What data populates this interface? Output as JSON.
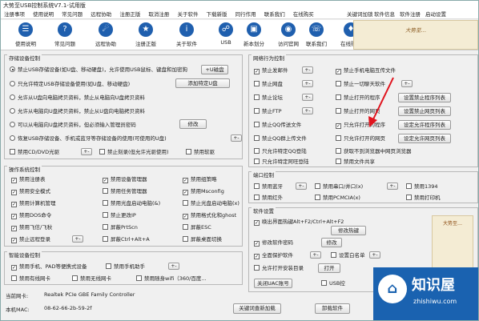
{
  "window": {
    "title": "大势至USB控制系统V7.1-试用版"
  },
  "menu": {
    "items": [
      "注册事项",
      "使用说明",
      "常见问题",
      "远程协助",
      "注册正版",
      "取消注册",
      "关于软件",
      "下载新版",
      "同行作用",
      "联系我们",
      "在线购买"
    ],
    "right": [
      "关键词加锁",
      "软件信息",
      "软件注册",
      "启动设置"
    ]
  },
  "toolbar": [
    {
      "label": "使用说明",
      "icon": "book-icon"
    },
    {
      "label": "常见问题",
      "icon": "question-icon"
    },
    {
      "label": "远程协助",
      "icon": "remote-icon"
    },
    {
      "label": "注册正版",
      "icon": "register-icon"
    },
    {
      "label": "关于软件",
      "icon": "info-icon"
    },
    {
      "label": "USB",
      "icon": "usb-icon"
    },
    {
      "label": "新本划分",
      "icon": "split-icon"
    },
    {
      "label": "访问官网",
      "icon": "globe-icon"
    },
    {
      "label": "联系我们",
      "icon": "contact-icon"
    },
    {
      "label": "在线购买",
      "icon": "cart-icon"
    }
  ],
  "banner": {
    "text": "大势至…"
  },
  "storage": {
    "title": "存储设备控制",
    "options": [
      {
        "label": "禁止USB存储设备(如U盘、移动硬盘)，允许使用USB鼠标、键盘和加密狗",
        "checked": true
      },
      {
        "label": "只允许特定USB存储设备使用(如U盘、移动硬盘)",
        "checked": false
      },
      {
        "label": "允许从U盘向电脑拷贝资料，禁止从电脑向U盘拷贝资料",
        "checked": false
      },
      {
        "label": "允许从电脑向U盘拷贝资料，禁止从U盘向电脑拷贝资料",
        "checked": false
      },
      {
        "label": "可以从电脑向U盘拷贝资料，但必须输入管理员密码",
        "checked": false
      },
      {
        "label": "恢复USB存储设备、手机或蓝牙等存储设备的使用(可使用的U盘)",
        "checked": false
      }
    ],
    "add_disk": "+U磁盘",
    "add_special": "添加特定U盘",
    "modify": "修改",
    "cdrom": "禁用CD/DVD光驱",
    "cdrom_extra": "禁止刻录(但允许光驱使用)",
    "floppy": "禁用软驱"
  },
  "ops": {
    "title": "操作系统控制",
    "items": [
      {
        "label": "禁用注册表",
        "checked": true
      },
      {
        "label": "禁用设备管理器",
        "checked": true
      },
      {
        "label": "禁用组策略",
        "checked": true
      },
      {
        "label": "禁用安全模式",
        "checked": true
      },
      {
        "label": "禁用任务管理器",
        "checked": false
      },
      {
        "label": "禁用Msconfig",
        "checked": true
      },
      {
        "label": "禁用计算机管理",
        "checked": true
      },
      {
        "label": "禁用光盘启动电脑(&)",
        "checked": false
      },
      {
        "label": "禁止光盘启动电脑(x)",
        "checked": false
      },
      {
        "label": "禁用DOS命令",
        "checked": true
      },
      {
        "label": "禁止更改IP",
        "checked": false
      },
      {
        "label": "禁用格式化和ghost",
        "checked": true
      },
      {
        "label": "禁用飞信/飞秋",
        "checked": true
      },
      {
        "label": "屏蔽PrtScn",
        "checked": false
      },
      {
        "label": "屏蔽ESC",
        "checked": false
      },
      {
        "label": "禁止远程登录",
        "checked": true
      },
      {
        "label": "屏蔽Ctrl+Alt+A",
        "checked": false
      },
      {
        "label": "屏蔽桌面切换",
        "checked": false
      }
    ]
  },
  "smart": {
    "title": "智能设备控制",
    "items": [
      "禁用手机、PAD等便携式设备",
      "禁用手机助手",
      "禁用有线网卡",
      "禁用无线网卡",
      "禁用随身wifi（360/百度..."
    ]
  },
  "nic": {
    "label": "当前网卡:",
    "value": "Realtek PCIe GBE Family Controller",
    "mac_label": "本机MAC:",
    "mac": "08-62-66-2b-59-2f"
  },
  "network": {
    "title": "网络行为控制",
    "left": [
      {
        "label": "禁止发邮件",
        "checked": true
      },
      {
        "label": "禁止网盘",
        "checked": false
      },
      {
        "label": "禁止论坛",
        "checked": false
      },
      {
        "label": "禁止FTP",
        "checked": false
      },
      {
        "label": "禁止QQ传送文件",
        "checked": false
      },
      {
        "label": "禁止QQ群上传文件",
        "checked": false
      },
      {
        "label": "只允许特定QQ登陆",
        "checked": false
      },
      {
        "label": "只允许特定阿旺登陆",
        "checked": false
      }
    ],
    "right": [
      {
        "label": "禁止手机电脑互传文件",
        "checked": true
      },
      {
        "label": "禁止一切聊天软件",
        "checked": false
      },
      {
        "label": "禁止打开的程序",
        "checked": false
      },
      {
        "label": "禁止打开的网页",
        "checked": false
      },
      {
        "label": "只允许打开的程序",
        "checked": true
      },
      {
        "label": "只允许打开的网页",
        "checked": false
      },
      {
        "label": "获取不到浏览器中网页浏览器",
        "checked": false
      },
      {
        "label": "禁用文件共享",
        "checked": false
      }
    ],
    "btns": [
      "设置禁止程序列表",
      "设置禁止网页列表",
      "设定允许程序列表",
      "设定允许网页列表"
    ]
  },
  "ports": {
    "title": "端口控制",
    "items": [
      "禁用蓝牙",
      "禁用串口/并口(x)",
      "禁用1394",
      "禁用红外",
      "禁用PCMCIA(x)",
      "禁用打印机"
    ]
  },
  "software": {
    "title": "软件设置",
    "hotkey": "唤出界面热键Alt+F2/Ctrl+Alt+F2",
    "hotkey_btn": "修改热键",
    "pwd": "修改软件密码",
    "pwd_btn": "修改",
    "protect": "全面保护软件",
    "whitelist": "设置白名单",
    "open": "打开",
    "autostart": "允许打开安装目录",
    "uac": "关闭UAC账号",
    "usb_label": "USB控",
    "checked": true
  },
  "seal": {
    "text": "大势至…"
  },
  "watermark": {
    "brand": "知识屋",
    "url": "zhishiwu.com"
  },
  "footer": {
    "btn1": "关键词查新加载",
    "btn2": "卸载软件"
  }
}
